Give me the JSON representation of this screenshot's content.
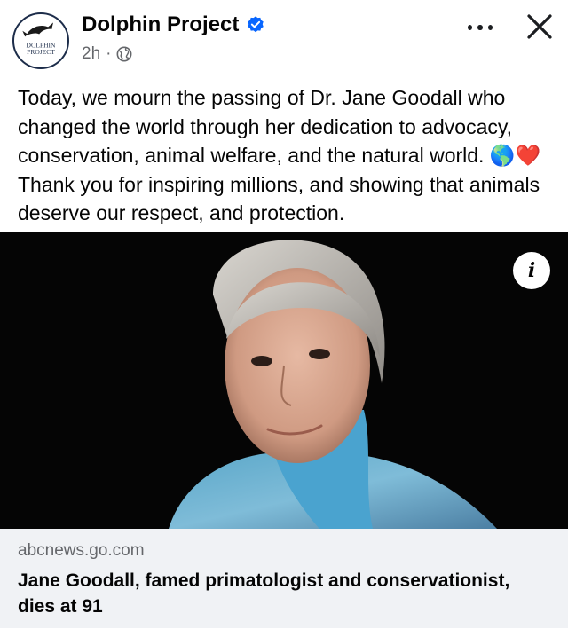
{
  "post": {
    "page_name": "Dolphin Project",
    "verified_icon": "verified-badge-icon",
    "time": "2h",
    "separator": "·",
    "audience_icon": "globe-icon",
    "avatar_text_line1": "DOLPHIN",
    "avatar_text_line2": "PROJECT",
    "text": "Today, we mourn the passing of Dr. Jane Goodall who changed the world through her dedication to advocacy, conservation, animal welfare, and the natural world. 🌎❤️ Thank you for inspiring millions, and showing that animals deserve our respect, and protection."
  },
  "actions": {
    "more_icon": "more-horizontal-icon",
    "close_icon": "close-icon",
    "info_label": "i"
  },
  "link_preview": {
    "domain": "abcnews.go.com",
    "title": "Jane Goodall, famed primatologist and conservationist, dies at 91"
  },
  "colors": {
    "verified": "#0866ff",
    "secondary_text": "#65676b",
    "card_background": "#f0f2f5",
    "photo_background": "#050505"
  }
}
